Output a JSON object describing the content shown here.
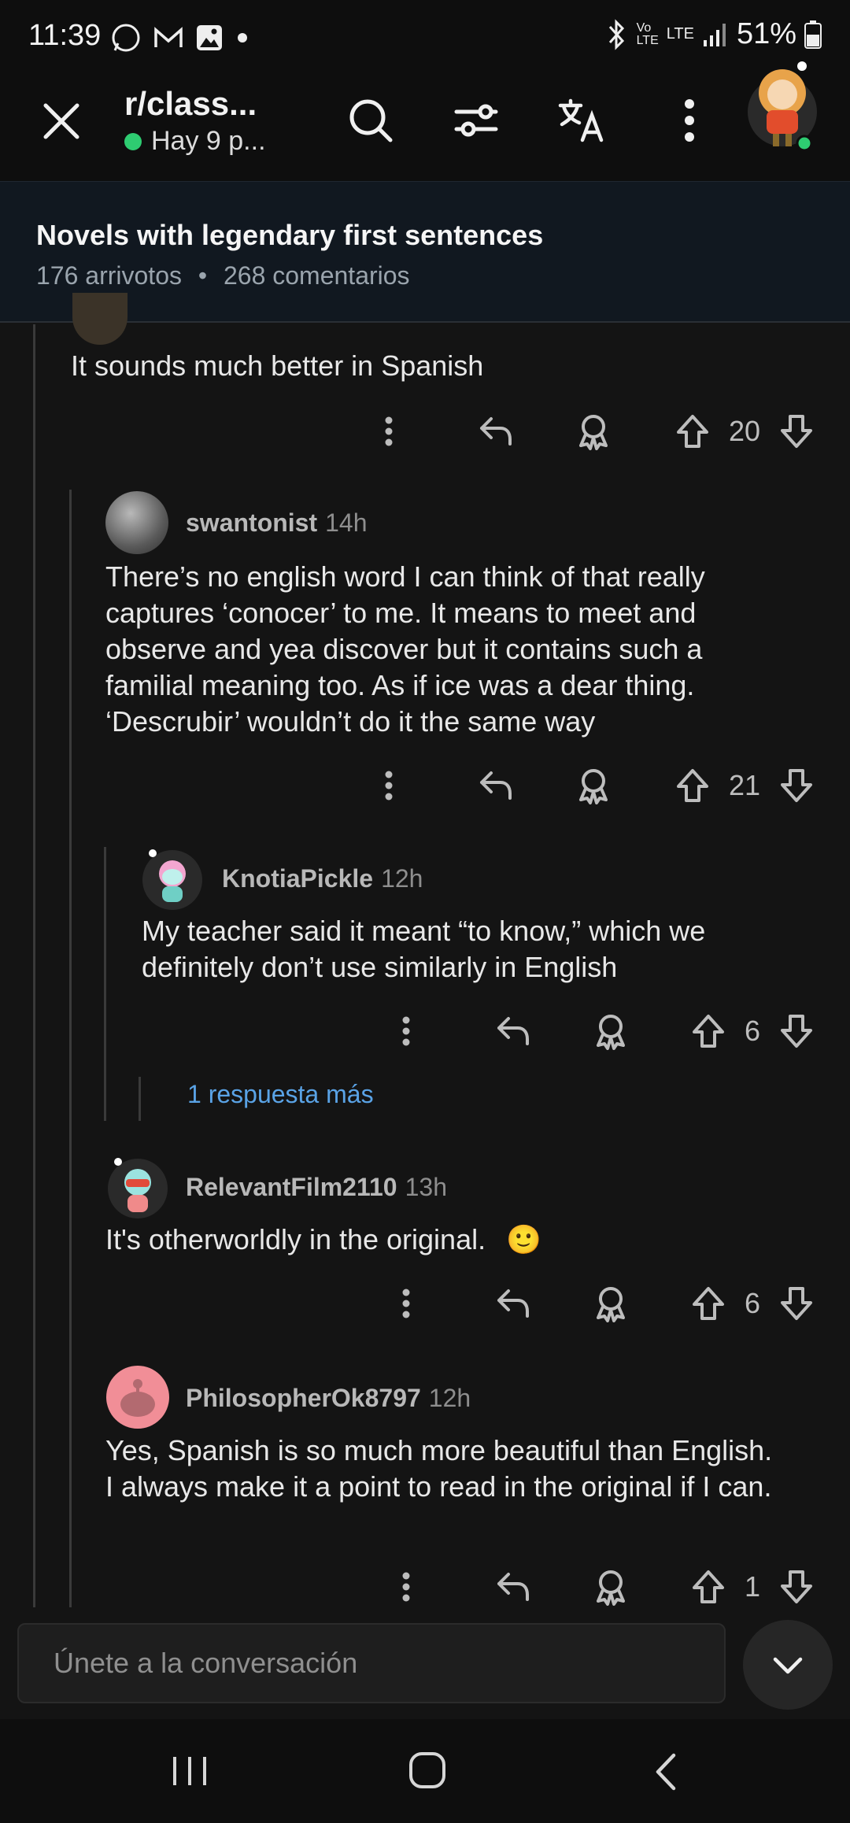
{
  "status_bar": {
    "time": "11:39",
    "battery": "51%",
    "network": "LTE"
  },
  "header": {
    "subreddit": "r/class...",
    "online": "Hay 9 p..."
  },
  "post": {
    "title": "Novels with legendary first sentences",
    "upvotes": "176 arrivotos",
    "comments": "268 comentarios"
  },
  "comments": [
    {
      "text": "It sounds much better in Spanish",
      "score": "20"
    },
    {
      "user": "swantonist",
      "time": "14h",
      "text": "There’s no english word I can think of that really captures ‘conocer’ to me. It means to meet and observe and yea discover but it contains such a familial meaning too. As if ice was a dear thing. ‘Descrubir’ wouldn’t do it the same way",
      "score": "21"
    },
    {
      "user": "KnotiaPickle",
      "time": "12h",
      "text": "My teacher said it meant “to know,” which we definitely don’t use similarly in English",
      "score": "6"
    },
    {
      "more": "1 respuesta más"
    },
    {
      "user": "RelevantFilm2110",
      "time": "13h",
      "text": "It's otherworldly in the original.",
      "emoji": "🙂",
      "score": "6"
    },
    {
      "user": "PhilosopherOk8797",
      "time": "12h",
      "text": "Yes, Spanish is so much more beautiful than English. I always make it a point to read in the original if I can.",
      "score": "1"
    }
  ],
  "composer": {
    "placeholder": "Únete a la conversación"
  },
  "colors": {
    "link": "#5aa3e6",
    "online": "#2ecc71",
    "background": "#141414"
  }
}
